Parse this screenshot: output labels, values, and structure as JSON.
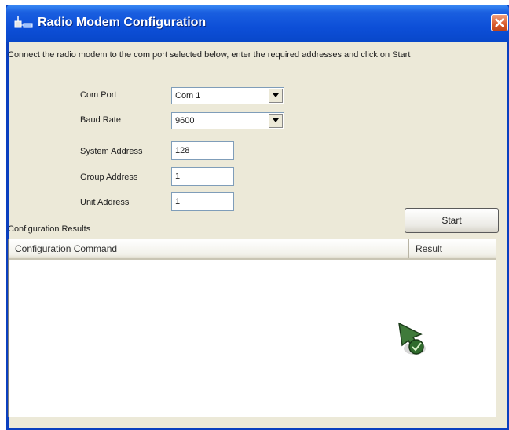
{
  "window": {
    "title": "Radio Modem Configuration"
  },
  "instruction": "Connect the radio modem to the com port selected below, enter the required addresses and click on Start",
  "com_port": {
    "label": "Com Port",
    "value": "Com 1"
  },
  "baud_rate": {
    "label": "Baud Rate",
    "value": "9600"
  },
  "system_address": {
    "label": "System Address",
    "value": "128"
  },
  "group_address": {
    "label": "Group Address",
    "value": "1"
  },
  "unit_address": {
    "label": "Unit Address",
    "value": "1"
  },
  "start_label": "Start",
  "results": {
    "label": "Configuration Results",
    "columns": [
      "Configuration Command",
      "Result"
    ],
    "rows": []
  },
  "colors": {
    "titlebar": "#0d4fd8",
    "window_bg": "#ece9d8",
    "close_button": "#d85a2a"
  },
  "icons": {
    "app": "radio-modem-icon",
    "close": "close-icon",
    "dropdown": "chevron-down-icon",
    "cursor": "pointer-cursor-icon"
  }
}
